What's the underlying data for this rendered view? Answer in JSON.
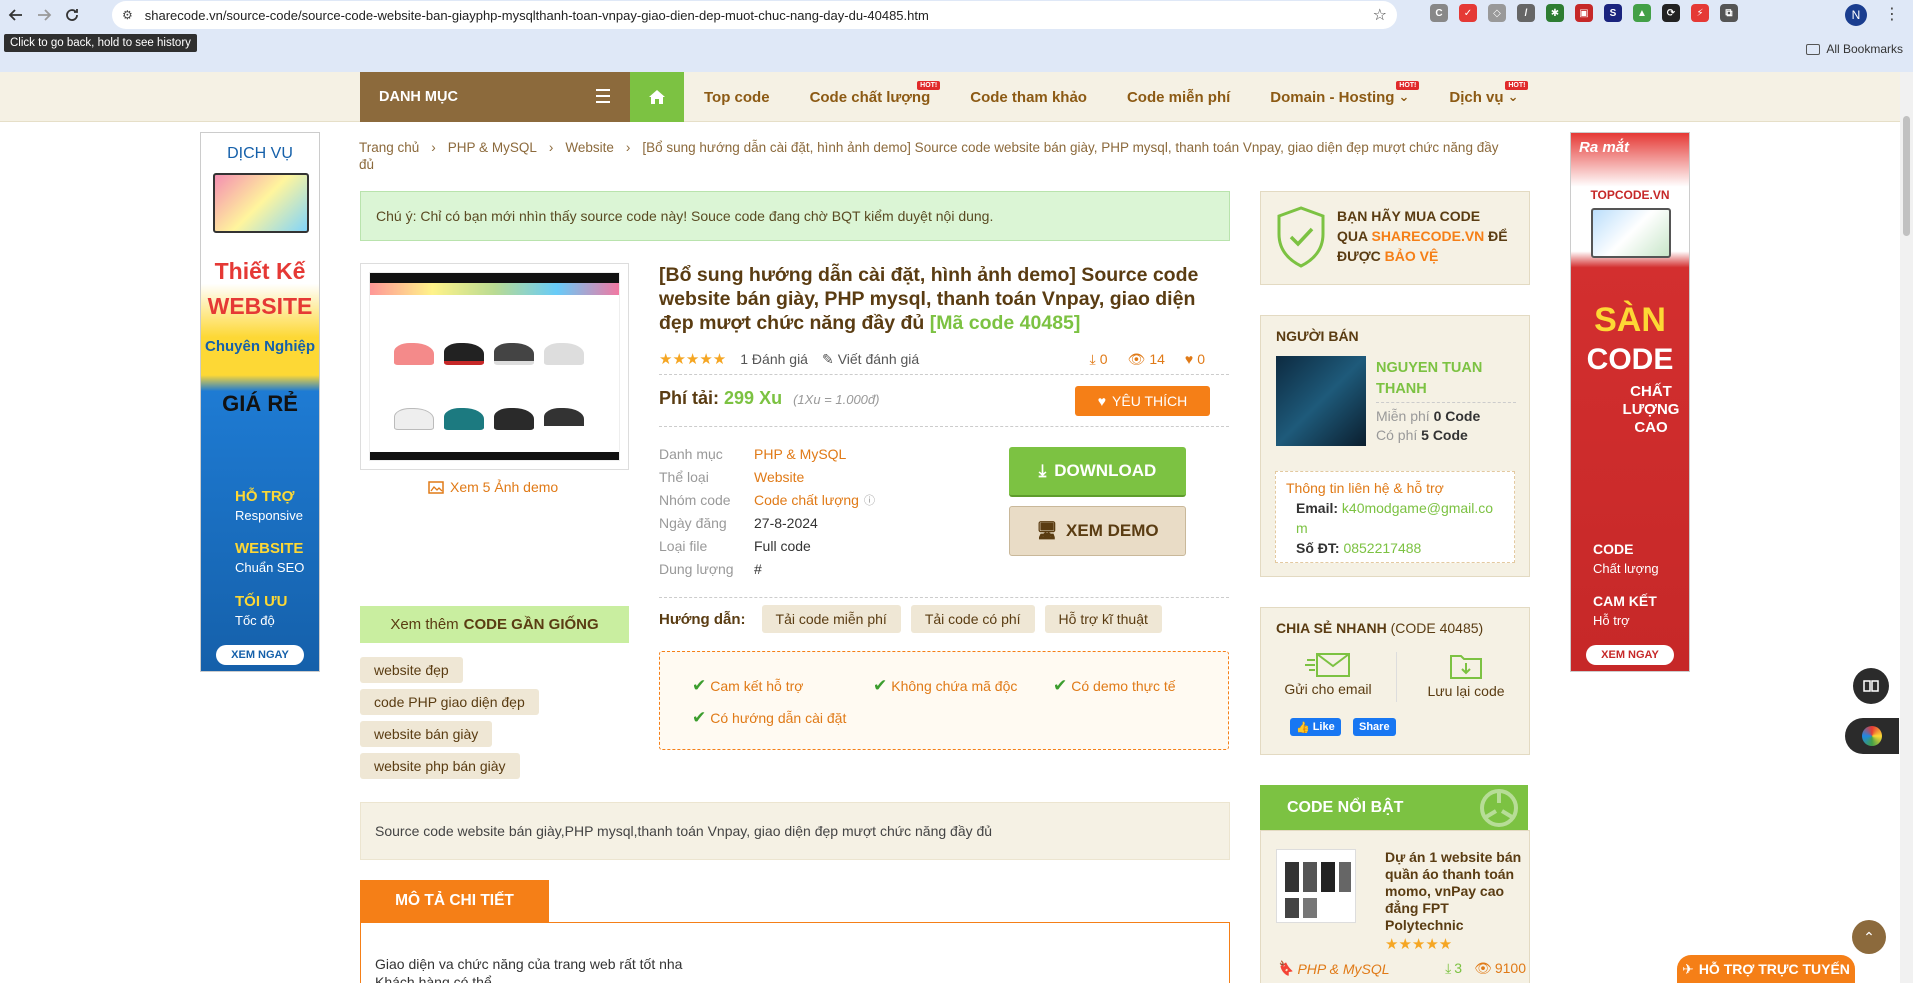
{
  "browser": {
    "url": "sharecode.vn/source-code/source-code-website-ban-giayphp-mysqlthanh-toan-vnpay-giao-dien-dep-muot-chuc-nang-day-du-40485.htm",
    "tooltip": "Click to go back, hold to see history",
    "profile_initial": "N",
    "bookmarks_label": "All Bookmarks"
  },
  "nav": {
    "danh_muc": "DANH MỤC",
    "links": [
      {
        "label": "Top code",
        "hot": false
      },
      {
        "label": "Code chất lượng",
        "hot": true
      },
      {
        "label": "Code tham khảo",
        "hot": false
      },
      {
        "label": "Code miễn phí",
        "hot": false
      },
      {
        "label": "Domain - Hosting",
        "hot": true,
        "chevron": "⌄"
      },
      {
        "label": "Dịch vụ",
        "hot": true,
        "chevron": "⌄"
      }
    ],
    "hot_label": "HOT!"
  },
  "banner_left": {
    "l1": "DỊCH VỤ",
    "l2": "Thiết Kế",
    "l3": "WEBSITE",
    "l4": "Chuyên Nghiệp",
    "l5": "GIÁ RẺ",
    "l6": "HỖ TRỢ",
    "l6b": "Responsive",
    "l7": "WEBSITE",
    "l7b": "Chuẩn SEO",
    "l8": "TỐI ƯU",
    "l8b": "Tốc độ",
    "cta": "XEM NGAY"
  },
  "banner_right": {
    "l1": "Ra mắt",
    "l2": "TOPCODE.VN",
    "l3": "SÀN",
    "l4": "CODE",
    "l5": "CHẤT LƯỢNG CAO",
    "l6": "CODE",
    "l6b": "Chất lượng",
    "l7": "CAM KẾT",
    "l7b": "Hỗ trợ",
    "cta": "XEM NGAY"
  },
  "breadcrumb": {
    "home": "Trang chủ",
    "cat": "PHP & MySQL",
    "sub": "Website",
    "current": "[Bổ sung hướng dẫn cài đặt, hình ảnh demo] Source code website bán giày, PHP mysql, thanh toán Vnpay, giao diện đẹp mượt chức năng đầy đủ",
    "sep": "›"
  },
  "notice": "Chú ý: Chỉ có bạn mới nhìn thấy source code này! Souce code đang chờ BQT kiểm duyệt nội dung.",
  "product": {
    "title": "[Bổ sung hướng dẫn cài đặt, hình ảnh demo] Source code website bán giày, PHP mysql, thanh toán Vnpay, giao diện đẹp mượt chức năng đầy đủ",
    "code": "[Mã code 40485]",
    "reviews": "1 Đánh giá",
    "write_review": "Viết đánh giá",
    "downloads": "0",
    "views": "14",
    "likes": "0",
    "fee_label": "Phí tải:",
    "fee_value": "299 Xu",
    "fee_rate": "(1Xu = 1.000đ)",
    "like_btn": "YÊU THÍCH",
    "view_images": "Xem 5 Ảnh demo",
    "info": [
      {
        "k": "Danh mục",
        "v": "PHP & MySQL",
        "link": true
      },
      {
        "k": "Thể loại",
        "v": "Website",
        "link": true
      },
      {
        "k": "Nhóm code",
        "v": "Code chất lượng",
        "link": true
      },
      {
        "k": "Ngày đăng",
        "v": "27-8-2024",
        "link": false
      },
      {
        "k": "Loại file",
        "v": "Full code",
        "link": false
      },
      {
        "k": "Dung lượng",
        "v": "#",
        "link": false
      }
    ],
    "download_btn": "DOWNLOAD",
    "demo_btn": "XEM DEMO",
    "guide_label": "Hướng dẫn:",
    "guide_pills": [
      "Tải code miễn phí",
      "Tải code có phí",
      "Hỗ trợ kĩ thuật"
    ],
    "guarantees": [
      "Cam kết hỗ trợ",
      "Không chứa mã độc",
      "Có demo thực tế",
      "Có hướng dẫn cài đặt"
    ]
  },
  "similar": {
    "prefix": "Xem thêm",
    "bold": "CODE GẦN GIỐNG",
    "tags": [
      "website đẹp",
      "code PHP giao diện đẹp",
      "website bán giày",
      "website php bán giày"
    ]
  },
  "summary": "Source code website bán giày,PHP mysql,thanh toán Vnpay, giao diện đẹp mượt chức năng đầy đủ",
  "detail": {
    "tab": "MÔ TẢ CHI TIẾT",
    "line1": "Giao diện va chức năng của trang web rất tốt nha",
    "line2": "Khách hàng có thể"
  },
  "sidebar": {
    "buy": {
      "t1": "BẠN HÃY MUA CODE",
      "t2": "QUA",
      "brand": "SHARECODE.VN",
      "t3": "ĐỂ",
      "t4": "ĐƯỢC",
      "protect": "BẢO VỆ"
    },
    "seller": {
      "title": "NGƯỜI BÁN",
      "name": "NGUYEN TUAN THANH",
      "free_label": "Miễn phí",
      "free_val": "0 Code",
      "paid_label": "Có phí",
      "paid_val": "5 Code",
      "contact_title": "Thông tin liên hệ & hỗ trợ",
      "email_label": "Email:",
      "email": "k40modgame@gmail.com",
      "phone_label": "Số ĐT:",
      "phone": "0852217488"
    },
    "share": {
      "title": "CHIA SẺ NHANH",
      "code": "(CODE 40485)",
      "email": "Gửi cho email",
      "save": "Lưu lại code",
      "like": "Like",
      "share": "Share"
    },
    "featured": {
      "title": "CODE NỔI BẬT",
      "item_title": "Dự án 1 website bán quần áo thanh toán momo, vnPay cao đẳng FPT Polytechnic",
      "item_cat": "PHP & MySQL",
      "item_dl": "3",
      "item_views": "9100"
    }
  },
  "support": "HỖ TRỢ TRỰC TUYẾN",
  "colors": {
    "brand_brown": "#8c6a3c",
    "accent_green": "#7cc242",
    "accent_orange": "#f57f17"
  }
}
